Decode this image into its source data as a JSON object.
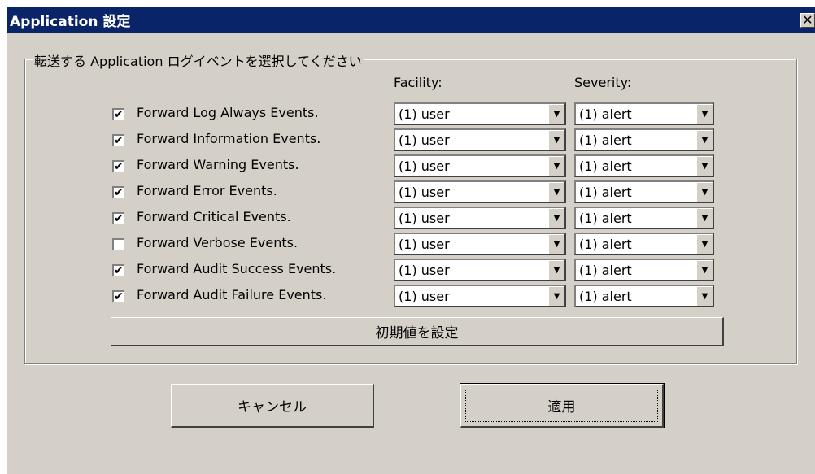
{
  "window": {
    "title": "Application 設定",
    "close_glyph": "✕"
  },
  "group": {
    "label": "転送する Application ログイベントを選択してください"
  },
  "columns": {
    "facility": "Facility:",
    "severity": "Severity:"
  },
  "rows": [
    {
      "label": "Forward Log Always Events.",
      "checked": true,
      "facility": "(1) user",
      "severity": "(1) alert"
    },
    {
      "label": "Forward Information Events.",
      "checked": true,
      "facility": "(1) user",
      "severity": "(1) alert"
    },
    {
      "label": "Forward Warning Events.",
      "checked": true,
      "facility": "(1) user",
      "severity": "(1) alert"
    },
    {
      "label": "Forward Error Events.",
      "checked": true,
      "facility": "(1) user",
      "severity": "(1) alert"
    },
    {
      "label": "Forward Critical Events.",
      "checked": true,
      "facility": "(1) user",
      "severity": "(1) alert"
    },
    {
      "label": "Forward Verbose Events.",
      "checked": false,
      "facility": "(1) user",
      "severity": "(1) alert"
    },
    {
      "label": "Forward Audit Success Events.",
      "checked": true,
      "facility": "(1) user",
      "severity": "(1) alert"
    },
    {
      "label": "Forward Audit Failure Events.",
      "checked": true,
      "facility": "(1) user",
      "severity": "(1) alert"
    }
  ],
  "buttons": {
    "defaults": "初期値を設定",
    "cancel": "キャンセル",
    "apply": "適用"
  },
  "icons": {
    "dropdown": "triangle-down-icon",
    "check": "checkmark-icon"
  },
  "colors": {
    "titlebar": "#0a246a",
    "face": "#d4d0c8"
  }
}
